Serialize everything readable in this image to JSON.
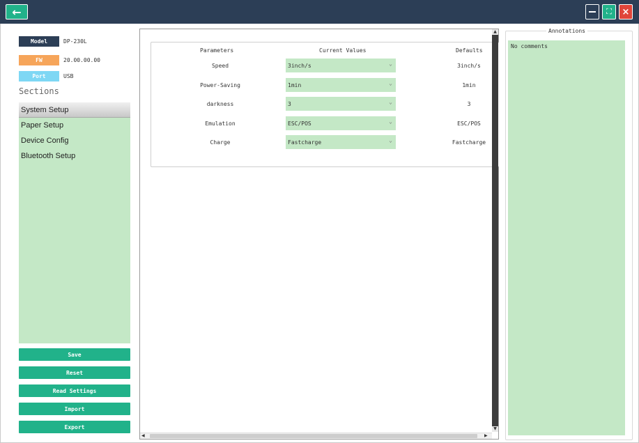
{
  "window": {
    "back_icon": "arrow-left-icon",
    "controls": {
      "minimize_icon": "minimize-icon",
      "maximize_icon": "maximize-icon",
      "close_icon": "close-icon",
      "close_glyph": "×"
    }
  },
  "device": {
    "model_label": "Model",
    "model_value": "DP-230L",
    "fw_label": "FW",
    "fw_value": "20.00.00.00",
    "port_label": "Port",
    "port_value": "USB"
  },
  "sections": {
    "title": "Sections",
    "items": [
      {
        "label": "System Setup",
        "active": true
      },
      {
        "label": "Paper Setup",
        "active": false
      },
      {
        "label": "Device Config",
        "active": false
      },
      {
        "label": "Bluetooth Setup",
        "active": false
      }
    ]
  },
  "actions": {
    "save": "Save",
    "reset": "Reset",
    "read_settings": "Read Settings",
    "import": "Import",
    "export": "Export"
  },
  "table": {
    "headers": {
      "parameters": "Parameters",
      "current": "Current Values",
      "defaults": "Defaults"
    },
    "rows": [
      {
        "param": "Speed",
        "current": "3inch/s",
        "default": "3inch/s"
      },
      {
        "param": "Power-Saving",
        "current": "1min",
        "default": "1min"
      },
      {
        "param": "darkness",
        "current": "3",
        "default": "3"
      },
      {
        "param": "Emulation",
        "current": "ESC/POS",
        "default": "ESC/POS"
      },
      {
        "param": "Charge",
        "current": "Fastcharge",
        "default": "Fastcharge"
      }
    ]
  },
  "annotations": {
    "title": "Annotations",
    "text": "No comments"
  },
  "colors": {
    "titlebar": "#2c3e56",
    "accent": "#21b28a",
    "panel_green": "#c4e8c6",
    "close": "#e0453a",
    "fw_tag": "#f6a55a",
    "port_tag": "#7ed7f4"
  }
}
